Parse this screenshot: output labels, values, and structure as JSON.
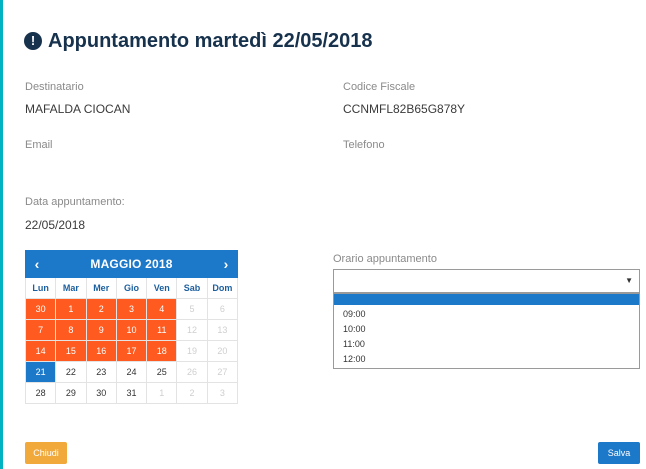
{
  "title": "Appuntamento martedì 22/05/2018",
  "fields": {
    "destinatario_label": "Destinatario",
    "destinatario_value": "MAFALDA CIOCAN",
    "codice_fiscale_label": "Codice Fiscale",
    "codice_fiscale_value": "CCNMFL82B65G878Y",
    "email_label": "Email",
    "telefono_label": "Telefono",
    "data_label": "Data appuntamento:",
    "data_value": "22/05/2018"
  },
  "calendar": {
    "month_label": "MAGGIO 2018",
    "prev": "‹",
    "next": "›",
    "weekdays": [
      "Lun",
      "Mar",
      "Mer",
      "Gio",
      "Ven",
      "Sab",
      "Dom"
    ],
    "weeks": [
      [
        {
          "d": "30",
          "s": "orange"
        },
        {
          "d": "1",
          "s": "orange"
        },
        {
          "d": "2",
          "s": "orange"
        },
        {
          "d": "3",
          "s": "orange"
        },
        {
          "d": "4",
          "s": "orange"
        },
        {
          "d": "5",
          "s": "muted"
        },
        {
          "d": "6",
          "s": "muted"
        }
      ],
      [
        {
          "d": "7",
          "s": "orange"
        },
        {
          "d": "8",
          "s": "orange"
        },
        {
          "d": "9",
          "s": "orange"
        },
        {
          "d": "10",
          "s": "orange"
        },
        {
          "d": "11",
          "s": "orange"
        },
        {
          "d": "12",
          "s": "muted"
        },
        {
          "d": "13",
          "s": "muted"
        }
      ],
      [
        {
          "d": "14",
          "s": "orange"
        },
        {
          "d": "15",
          "s": "orange"
        },
        {
          "d": "16",
          "s": "orange"
        },
        {
          "d": "17",
          "s": "orange"
        },
        {
          "d": "18",
          "s": "orange"
        },
        {
          "d": "19",
          "s": "muted"
        },
        {
          "d": "20",
          "s": "muted"
        }
      ],
      [
        {
          "d": "21",
          "s": "today"
        },
        {
          "d": "22",
          "s": "normal"
        },
        {
          "d": "23",
          "s": "normal"
        },
        {
          "d": "24",
          "s": "normal"
        },
        {
          "d": "25",
          "s": "normal"
        },
        {
          "d": "26",
          "s": "muted"
        },
        {
          "d": "27",
          "s": "muted"
        }
      ],
      [
        {
          "d": "28",
          "s": "normal"
        },
        {
          "d": "29",
          "s": "normal"
        },
        {
          "d": "30",
          "s": "normal"
        },
        {
          "d": "31",
          "s": "normal"
        },
        {
          "d": "1",
          "s": "muted"
        },
        {
          "d": "2",
          "s": "muted"
        },
        {
          "d": "3",
          "s": "muted"
        }
      ]
    ]
  },
  "orario": {
    "label": "Orario appuntamento",
    "selected": "",
    "options": [
      "09:00",
      "10:00",
      "11:00",
      "12:00"
    ]
  },
  "buttons": {
    "close": "Chiudi",
    "save": "Salva"
  },
  "colors": {
    "accent": "#00b2c2",
    "primary": "#1c78c8",
    "unavailable": "#ff5a1f",
    "close_button": "#f2a93b"
  }
}
